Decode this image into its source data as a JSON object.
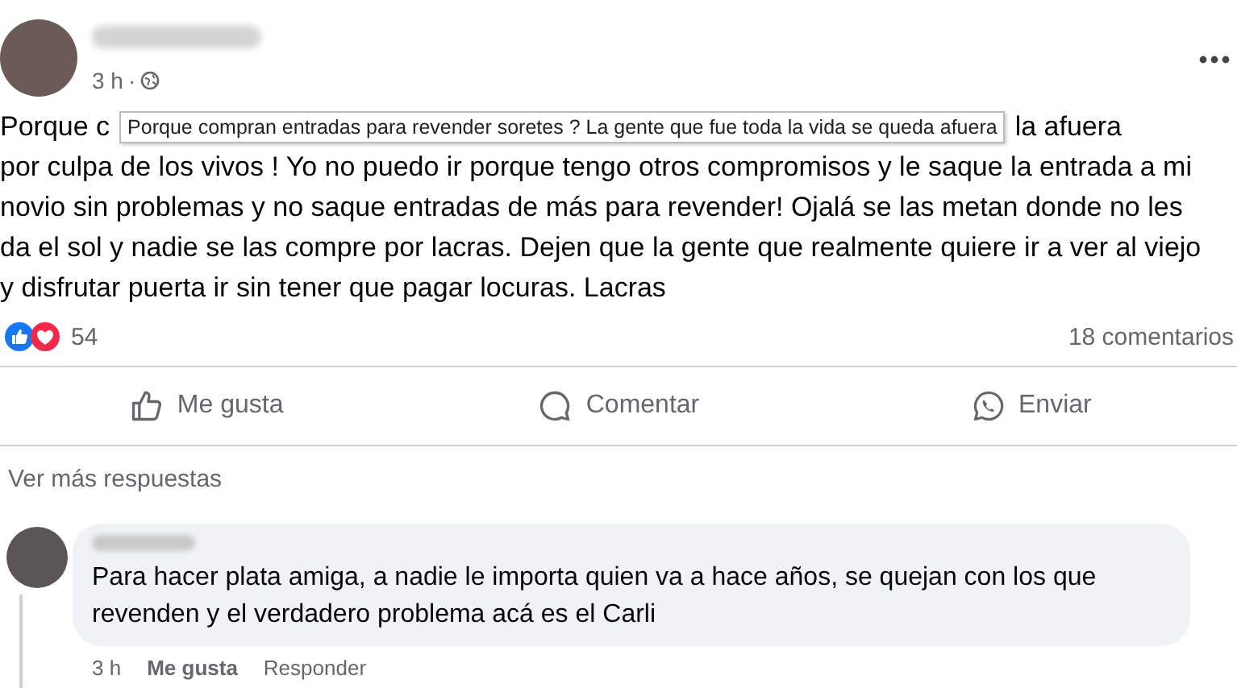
{
  "post": {
    "time": "3 h",
    "separator": "·",
    "line_1_start": "Porque c",
    "line_1_end": "la afuera",
    "lines": [
      "por culpa de los vivos ! Yo no puedo ir porque tengo otros compromisos y le saque la entrada a mi",
      "novio sin problemas y no saque entradas de más para revender! Ojalá se las metan donde no les",
      "da el sol y nadie se las compre por lacras.  Dejen que la gente que realmente quiere ir a ver al viejo",
      "y disfrutar puerta ir sin tener que pagar locuras.  Lacras"
    ]
  },
  "tooltip": {
    "text": "Porque compran entradas para revender soretes ? La gente que fue toda la vida se queda afuera"
  },
  "reactions": {
    "count": "54",
    "comments": "18 comentarios"
  },
  "actions": [
    {
      "kind": "like",
      "label": "Me gusta"
    },
    {
      "kind": "comment",
      "label": "Comentar"
    },
    {
      "kind": "send",
      "label": "Enviar"
    }
  ],
  "more_replies": "Ver más respuestas",
  "comment": {
    "text": "Para hacer plata amiga, a nadie le importa quien va a hace años, se quejan con los que revenden y el verdadero problema acá es el Carli",
    "time": "3 h",
    "like": "Me gusta",
    "reply": "Responder"
  }
}
